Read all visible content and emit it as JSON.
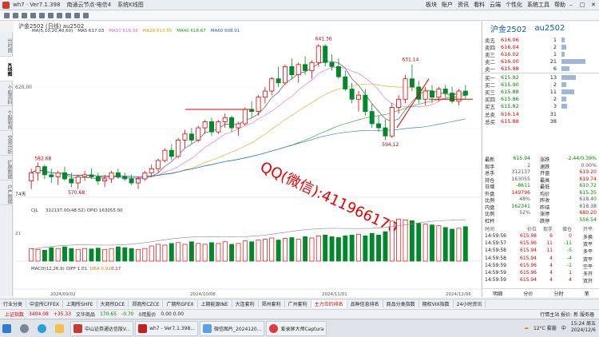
{
  "titlebar": {
    "app_title": "wh7 · Ver7.1.398",
    "menu": [
      "期货",
      "文件",
      "画面",
      "行情",
      "系统",
      "功能",
      "帮助"
    ],
    "server": "南通云节点·电信4",
    "mode": "系统K线图",
    "right_menu": [
      "板块",
      "账户",
      "资讯",
      "看料",
      "云端",
      "个性化",
      "系统工具",
      "帮助"
    ]
  },
  "left_tabs": [
    "分时图",
    "K线图",
    "个股资料",
    "个股新闻",
    "交易分析",
    "扩展数据",
    "户产数据"
  ],
  "chart": {
    "header_text": "沪金2502  (日线)  au2502",
    "ma_labels": [
      {
        "text": "MA(5,10,20,40,60)",
        "color": "#333333"
      },
      {
        "text": "MA5 617.03",
        "color": "#333333"
      },
      {
        "text": "MA10 616.36",
        "color": "#e05adc"
      },
      {
        "text": "MA20 613.35",
        "color": "#d9a000"
      },
      {
        "text": "MA40 618.67",
        "color": "#1d9a1d"
      },
      {
        "text": "MA60 608.91",
        "color": "#1760c9"
      }
    ],
    "price_labels": [
      "641.36",
      "631.14",
      "594.12",
      "582.68",
      "570.68"
    ],
    "axis_price": "620.00",
    "axis_note": "74天",
    "watermark": "QQ(微信):411966170",
    "volume_header": "CJL",
    "volume_stats": "312137.00(48:52)  OPID 163055.00",
    "macd_header": "MACD(12,26,9)",
    "macd_diff": "DIFF 1.01",
    "macd_dea": "DEA 0.92",
    "macd_value": "0.17",
    "date_labels": [
      "2024/09/02",
      "2024/10/08",
      "2024/11/01",
      "2024/12/06"
    ],
    "vol_axis": "21"
  },
  "chart_data": {
    "type": "candlestick",
    "ohlc": [
      [
        574,
        580,
        570,
        578
      ],
      [
        578,
        583,
        574,
        581
      ],
      [
        581,
        582,
        575,
        577
      ],
      [
        577,
        580,
        573,
        576
      ],
      [
        576,
        579,
        572,
        578
      ],
      [
        578,
        581,
        574,
        575
      ],
      [
        575,
        578,
        571,
        573
      ],
      [
        573,
        577,
        570,
        576
      ],
      [
        576,
        579,
        574,
        577
      ],
      [
        577,
        580,
        575,
        576
      ],
      [
        576,
        578,
        572,
        574
      ],
      [
        574,
        577,
        571,
        575
      ],
      [
        575,
        579,
        573,
        578
      ],
      [
        578,
        580,
        575,
        576
      ],
      [
        576,
        578,
        574,
        575
      ],
      [
        575,
        577,
        572,
        573
      ],
      [
        573,
        576,
        570,
        575
      ],
      [
        575,
        579,
        574,
        578
      ],
      [
        578,
        582,
        576,
        580
      ],
      [
        580,
        585,
        578,
        584
      ],
      [
        584,
        590,
        583,
        589
      ],
      [
        589,
        592,
        584,
        586
      ],
      [
        586,
        595,
        585,
        594
      ],
      [
        594,
        599,
        590,
        597
      ],
      [
        597,
        600,
        592,
        594
      ],
      [
        594,
        601,
        593,
        600
      ],
      [
        600,
        604,
        597,
        603
      ],
      [
        603,
        605,
        596,
        598
      ],
      [
        598,
        604,
        597,
        603
      ],
      [
        603,
        607,
        600,
        605
      ],
      [
        605,
        606,
        598,
        600
      ],
      [
        600,
        603,
        596,
        602
      ],
      [
        602,
        610,
        601,
        609
      ],
      [
        609,
        613,
        605,
        608
      ],
      [
        608,
        616,
        606,
        615
      ],
      [
        615,
        620,
        612,
        618
      ],
      [
        618,
        625,
        616,
        624
      ],
      [
        624,
        630,
        620,
        622
      ],
      [
        622,
        631,
        621,
        630
      ],
      [
        630,
        634,
        624,
        626
      ],
      [
        626,
        632,
        622,
        631
      ],
      [
        631,
        635,
        626,
        628
      ],
      [
        628,
        633,
        624,
        632
      ],
      [
        632,
        641,
        630,
        640
      ],
      [
        640,
        641,
        630,
        632
      ],
      [
        632,
        636,
        628,
        630
      ],
      [
        630,
        634,
        624,
        625
      ],
      [
        625,
        628,
        618,
        619
      ],
      [
        619,
        622,
        612,
        614
      ],
      [
        614,
        618,
        608,
        616
      ],
      [
        616,
        619,
        606,
        608
      ],
      [
        608,
        612,
        600,
        602
      ],
      [
        602,
        606,
        598,
        600
      ],
      [
        600,
        604,
        594,
        596
      ],
      [
        596,
        612,
        595,
        610
      ],
      [
        610,
        616,
        607,
        614
      ],
      [
        614,
        626,
        612,
        624
      ],
      [
        624,
        631,
        618,
        620
      ],
      [
        620,
        623,
        612,
        614
      ],
      [
        614,
        620,
        611,
        618
      ],
      [
        618,
        621,
        612,
        615
      ],
      [
        615,
        620,
        613,
        619
      ],
      [
        619,
        621,
        615,
        617
      ],
      [
        617,
        620,
        612,
        613
      ],
      [
        613,
        619,
        611,
        618
      ],
      [
        618,
        621,
        614,
        616
      ]
    ],
    "volume": [
      30,
      28,
      26,
      32,
      30,
      34,
      30,
      28,
      30,
      29,
      31,
      28,
      30,
      34,
      32,
      30,
      28,
      30,
      36,
      40,
      38,
      42,
      44,
      40,
      46,
      42,
      40,
      44,
      42,
      46,
      40,
      42,
      48,
      46,
      50,
      52,
      55,
      50,
      54,
      56,
      52,
      58,
      55,
      60,
      62,
      58,
      56,
      60,
      62,
      64,
      60,
      66,
      62,
      70,
      95,
      100,
      98,
      96,
      90,
      88,
      86,
      84,
      80,
      76,
      78,
      82
    ],
    "annotations": [
      "641.36",
      "631.14",
      "594.12",
      "582.68",
      "570.68"
    ]
  },
  "quote": {
    "name": "沪金2502",
    "code": "au2502",
    "sells": [
      {
        "label": "卖五",
        "price": "616.06",
        "qty": "1",
        "bar": 4
      },
      {
        "label": "卖四",
        "price": "616.04",
        "qty": "2",
        "bar": 6
      },
      {
        "label": "卖三",
        "price": "616.02",
        "qty": "1",
        "bar": 4
      },
      {
        "label": "卖二",
        "price": "616.00",
        "qty": "21",
        "bar": 30
      },
      {
        "label": "卖一",
        "price": "615.98",
        "qty": "6",
        "bar": 10
      }
    ],
    "buys": [
      {
        "label": "买一",
        "price": "615.92",
        "qty": "13",
        "bar": 18
      },
      {
        "label": "买二",
        "price": "615.90",
        "qty": "2",
        "bar": 6
      },
      {
        "label": "买三",
        "price": "615.88",
        "qty": "11",
        "bar": 16
      },
      {
        "label": "买四",
        "price": "615.86",
        "qty": "2",
        "bar": 6
      },
      {
        "label": "买五",
        "price": "615.82",
        "qty": "3",
        "bar": 7
      }
    ],
    "totals": [
      {
        "label": "总卖",
        "price": "616.14",
        "qty": "31"
      },
      {
        "label": "总买",
        "price": "615.88",
        "qty": "38"
      }
    ],
    "stats": [
      {
        "l1": "最新",
        "v1": "615.94",
        "l2": "涨跌",
        "v2": "-2.44/0.39%",
        "c1": "green",
        "c2": "green"
      },
      {
        "l1": "现手",
        "v1": "2",
        "l2": "速跌",
        "v2": "0.00%",
        "c1": "gray",
        "c2": "gray"
      },
      {
        "l1": "总手",
        "v1": "312137",
        "l2": "开盘",
        "v2": "619.20",
        "c1": "gray",
        "c2": "red"
      },
      {
        "l1": "持仓",
        "v1": "163055",
        "l2": "最高",
        "v2": "619.74",
        "c1": "gray",
        "c2": "red"
      },
      {
        "l1": "日增",
        "v1": "-8611",
        "l2": "最低",
        "v2": "610.72",
        "c1": "green",
        "c2": "green"
      },
      {
        "l1": "外盘",
        "v1": "149796",
        "l2": "均价",
        "v2": "615.35",
        "c1": "red",
        "c2": "green"
      },
      {
        "l1": "比例",
        "v1": "48%",
        "l2": "昨收",
        "v2": "618.40",
        "c1": "gray",
        "c2": "gray"
      },
      {
        "l1": "内盘",
        "v1": "162341",
        "l2": "昨结",
        "v2": "618.38",
        "c1": "green",
        "c2": "gray"
      },
      {
        "l1": "比例",
        "v1": "52%",
        "l2": "涨停",
        "v2": "680.20",
        "c1": "gray",
        "c2": "red"
      },
      {
        "l1": "杠杆",
        "v1": "",
        "l2": "跌停",
        "v2": "556.54",
        "c1": "gray",
        "c2": "green"
      }
    ],
    "trades_header": {
      "time": "时间",
      "price": "价位",
      "qty": "现手",
      "oi": "增仓",
      "open": "开平"
    },
    "trades": [
      {
        "time": "14:59:56",
        "price": "615.98",
        "qty": "6",
        "oi": "0",
        "open": "多换"
      },
      {
        "time": "14:59:57",
        "price": "615.96",
        "qty": "11",
        "oi": "-11",
        "open": "双平"
      },
      {
        "time": "14:59:58",
        "price": "615.94",
        "qty": "11",
        "oi": "-5",
        "open": "多平"
      },
      {
        "time": "14:59:58",
        "price": "615.94",
        "qty": "4",
        "oi": "-4",
        "open": "双平"
      },
      {
        "time": "14:59:59",
        "price": "615.96",
        "qty": "4",
        "oi": "-1",
        "open": "空平"
      },
      {
        "time": "14:59:59",
        "price": "615.96",
        "qty": "4",
        "oi": "1",
        "open": "多开"
      },
      {
        "time": "14:59:59",
        "price": "615.94",
        "qty": "4",
        "oi": "4",
        "open": "双开"
      }
    ],
    "footer_tabs": [
      "明细",
      "分价",
      "分时",
      "笔"
    ]
  },
  "bottom_tabs": [
    "行业分类",
    "中金所CFFEX",
    "上期所SHFE",
    "大商所DCE",
    "郑商所CZCE",
    "广期所GFEX",
    "上期能源INE",
    "大连套利",
    "郑州套利",
    "广州套利",
    "主力合约排名",
    "品种信息排名",
    "商品分类指数",
    "期权VIX指数",
    "24小时资讯"
  ],
  "statusbar": {
    "index": "上证指数",
    "index_val": "3404.08",
    "index_chg": "+35.33",
    "a2": "文华商品",
    "a2_val": "170.65",
    "a2_chg": "-0.70",
    "a3": "0用股价",
    "a3_val": "0.00  0.00",
    "right": "行情主站  报价: 新 服务器"
  },
  "taskbar": {
    "apps": [
      "中山证券通达信版V...",
      "wh7 - Ver7.1.398...",
      "微信图片_2024120...",
      "爱录屏大师Captura"
    ],
    "weather": "12°C 雾霾",
    "ime": "中",
    "time": "15:24 周五",
    "date": "2024/12/6"
  }
}
